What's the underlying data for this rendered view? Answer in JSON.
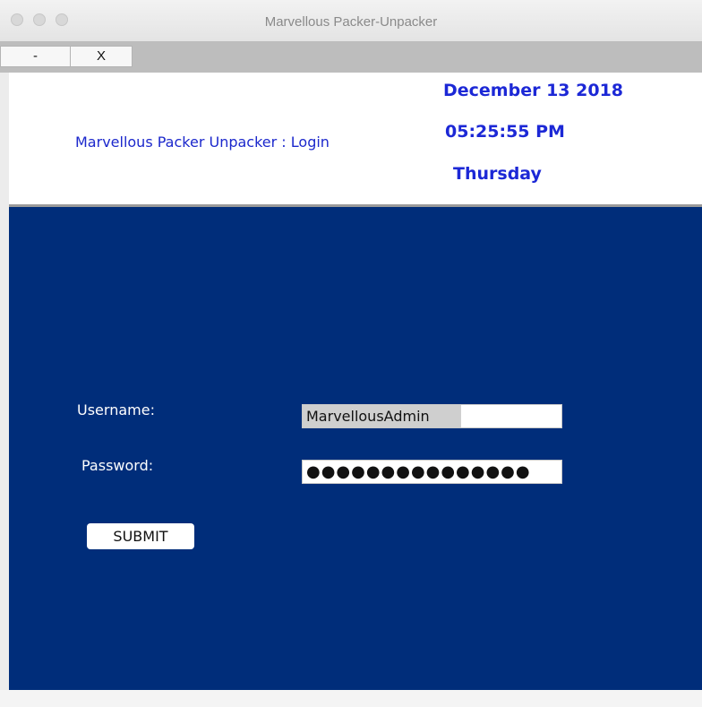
{
  "window": {
    "title": "Marvellous Packer-Unpacker",
    "minimize_label": "-",
    "close_label": "X"
  },
  "header": {
    "app_title": "Marvellous Packer Unpacker : Login",
    "date": "December 13 2018",
    "time": "05:25:55 PM",
    "day": "Thursday"
  },
  "login": {
    "username_label": "Username:",
    "username_value": "MarvellousAdmin",
    "password_label": "Password:",
    "password_value": "●●●●●●●●●●●●●●●",
    "submit_label": "SUBMIT"
  },
  "colors": {
    "panel_bg": "#002d7a",
    "header_text": "#1c28d6"
  }
}
